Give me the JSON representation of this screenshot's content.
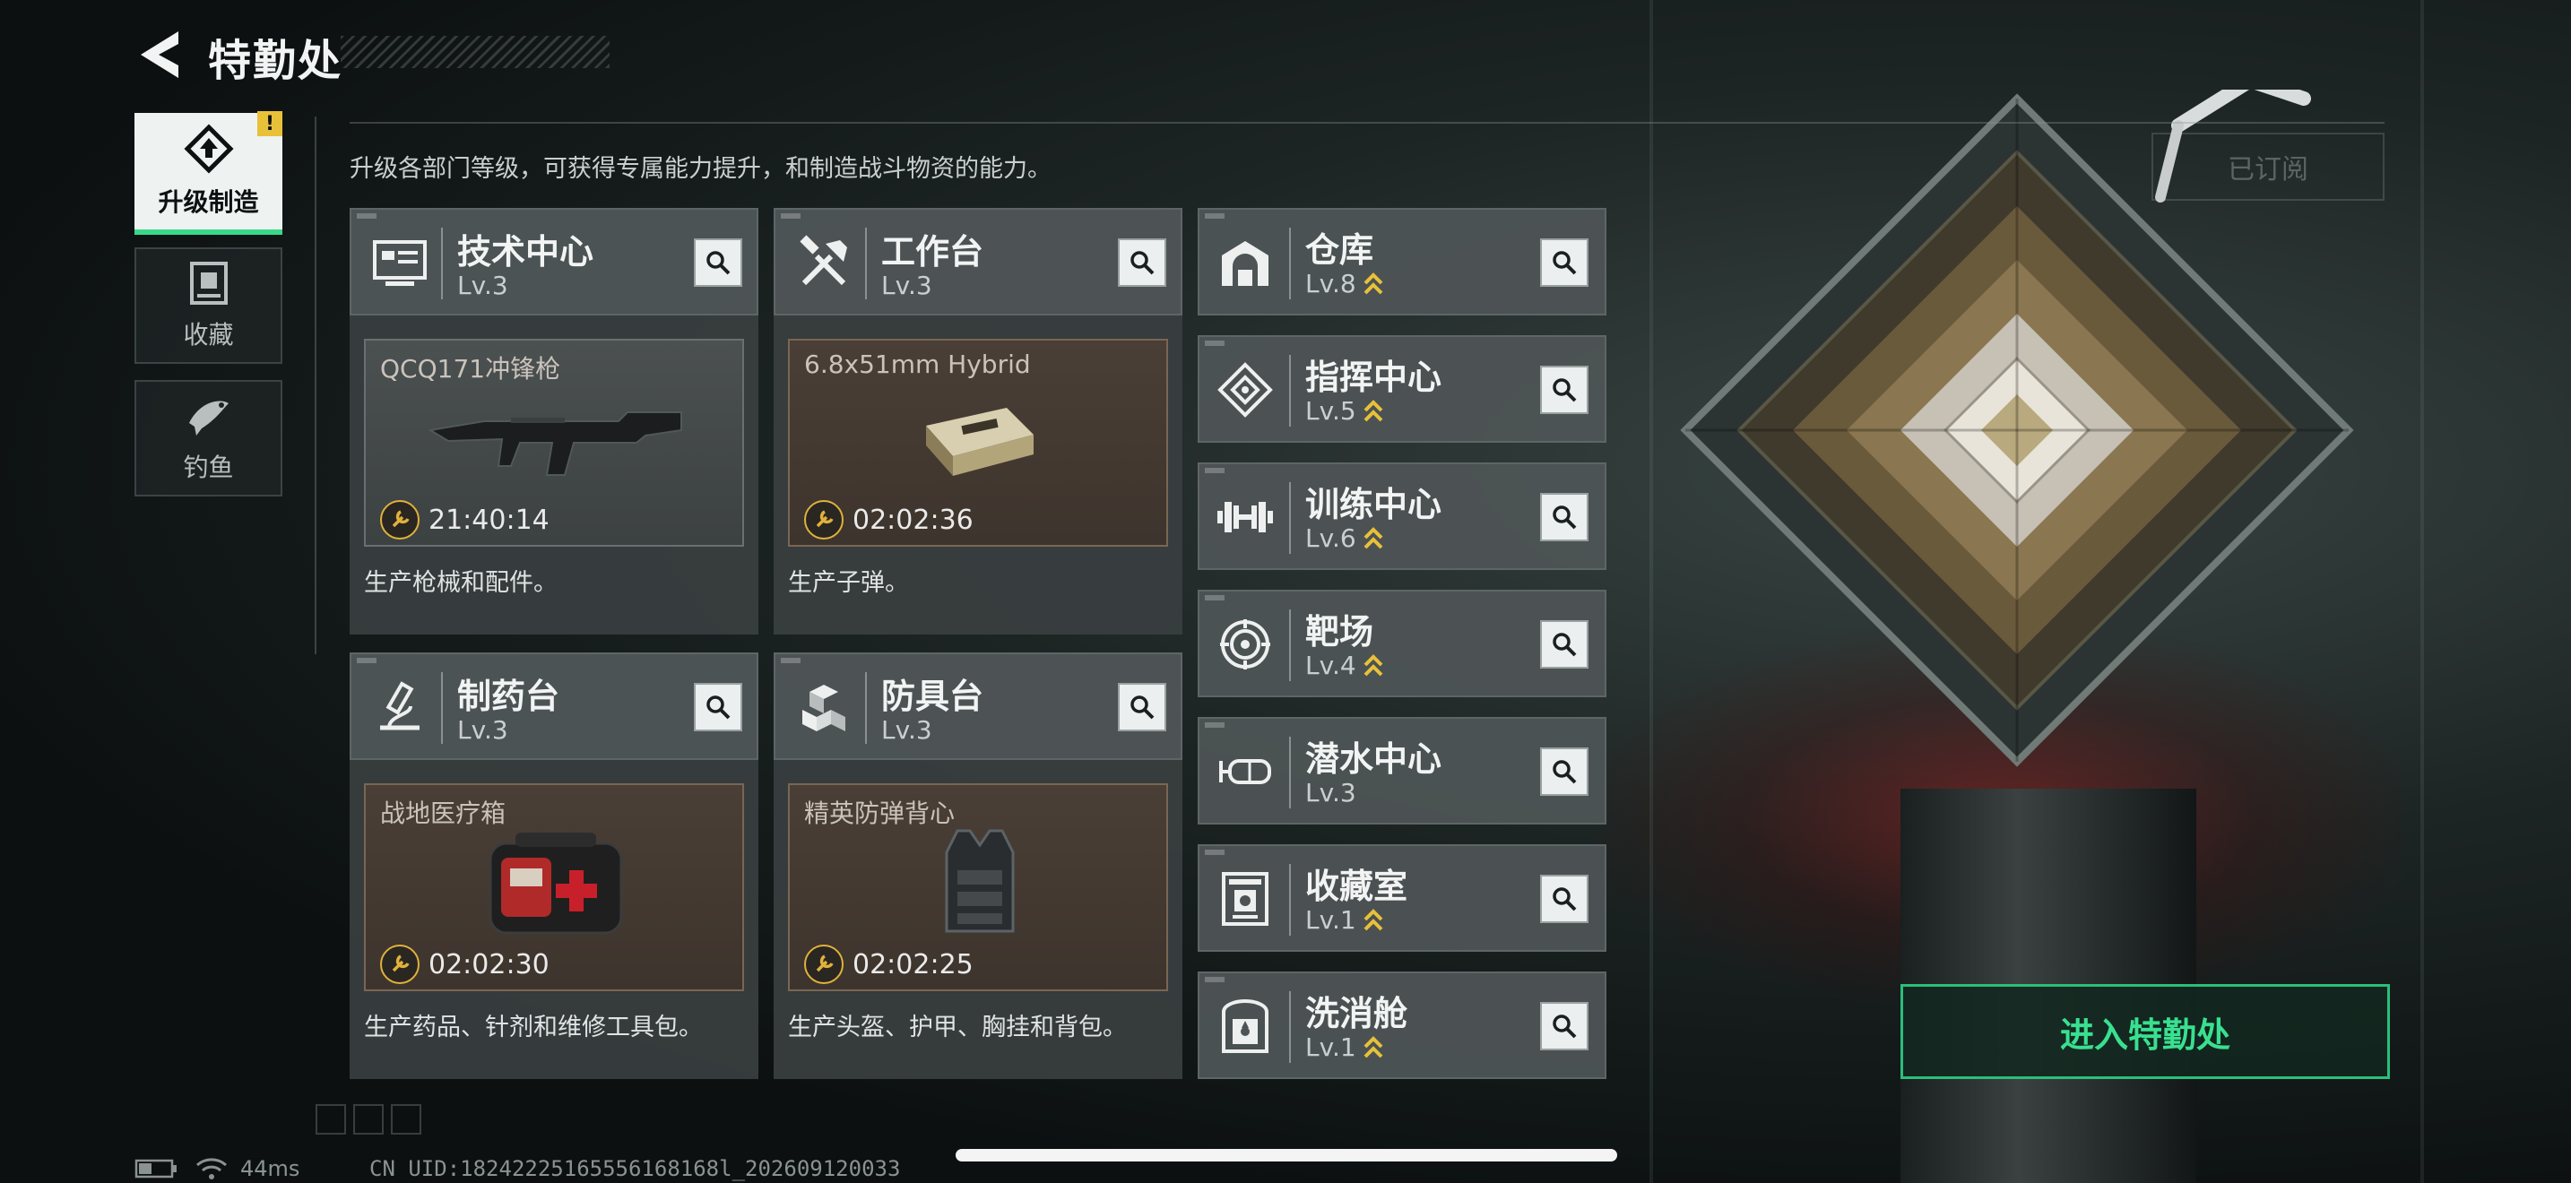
{
  "header": {
    "title": "特勤处"
  },
  "subtitle": "升级各部门等级，可获得专属能力提升，和制造战斗物资的能力。",
  "side_tabs": [
    {
      "label": "升级制造",
      "icon": "upgrade-icon",
      "active": true,
      "badge": "!"
    },
    {
      "label": "收藏",
      "icon": "collection-icon",
      "active": false
    },
    {
      "label": "钓鱼",
      "icon": "fish-icon",
      "active": false
    }
  ],
  "big_cards": [
    {
      "name": "技术中心",
      "level": "Lv.3",
      "icon": "tech-center-icon",
      "product": "QCQ171冲锋枪",
      "timer": "21:40:14",
      "desc": "生产枪械和配件。"
    },
    {
      "name": "工作台",
      "level": "Lv.3",
      "icon": "workbench-icon",
      "product": "6.8x51mm Hybrid",
      "timer": "02:02:36",
      "desc": "生产子弹。"
    },
    {
      "name": "制药台",
      "level": "Lv.3",
      "icon": "pharmacy-icon",
      "product": "战地医疗箱",
      "timer": "02:02:30",
      "desc": "生产药品、针剂和维修工具包。"
    },
    {
      "name": "防具台",
      "level": "Lv.3",
      "icon": "armor-bench-icon",
      "product": "精英防弹背心",
      "timer": "02:02:25",
      "desc": "生产头盔、护甲、胸挂和背包。"
    }
  ],
  "list_cards": [
    {
      "name": "仓库",
      "level": "Lv.8",
      "icon": "warehouse-icon",
      "upgradable": true
    },
    {
      "name": "指挥中心",
      "level": "Lv.5",
      "icon": "command-center-icon",
      "upgradable": true
    },
    {
      "name": "训练中心",
      "level": "Lv.6",
      "icon": "dumbbell-icon",
      "upgradable": true
    },
    {
      "name": "靶场",
      "level": "Lv.4",
      "icon": "target-icon",
      "upgradable": true
    },
    {
      "name": "潜水中心",
      "level": "Lv.3",
      "icon": "diving-mask-icon",
      "upgradable": false
    },
    {
      "name": "收藏室",
      "level": "Lv.1",
      "icon": "collection-room-icon",
      "upgradable": true
    },
    {
      "name": "洗消舱",
      "level": "Lv.1",
      "icon": "decontamination-icon",
      "upgradable": true
    }
  ],
  "subscribed_label": "已订阅",
  "enter_button": "进入特勤处",
  "status": {
    "ping": "44ms",
    "uid": "CN UID:18242225165556168168l_202609120033"
  },
  "colors": {
    "accent_green": "#39e08f",
    "upgrade_arrow": "#e8c13a",
    "badge": "#e8c13a"
  }
}
